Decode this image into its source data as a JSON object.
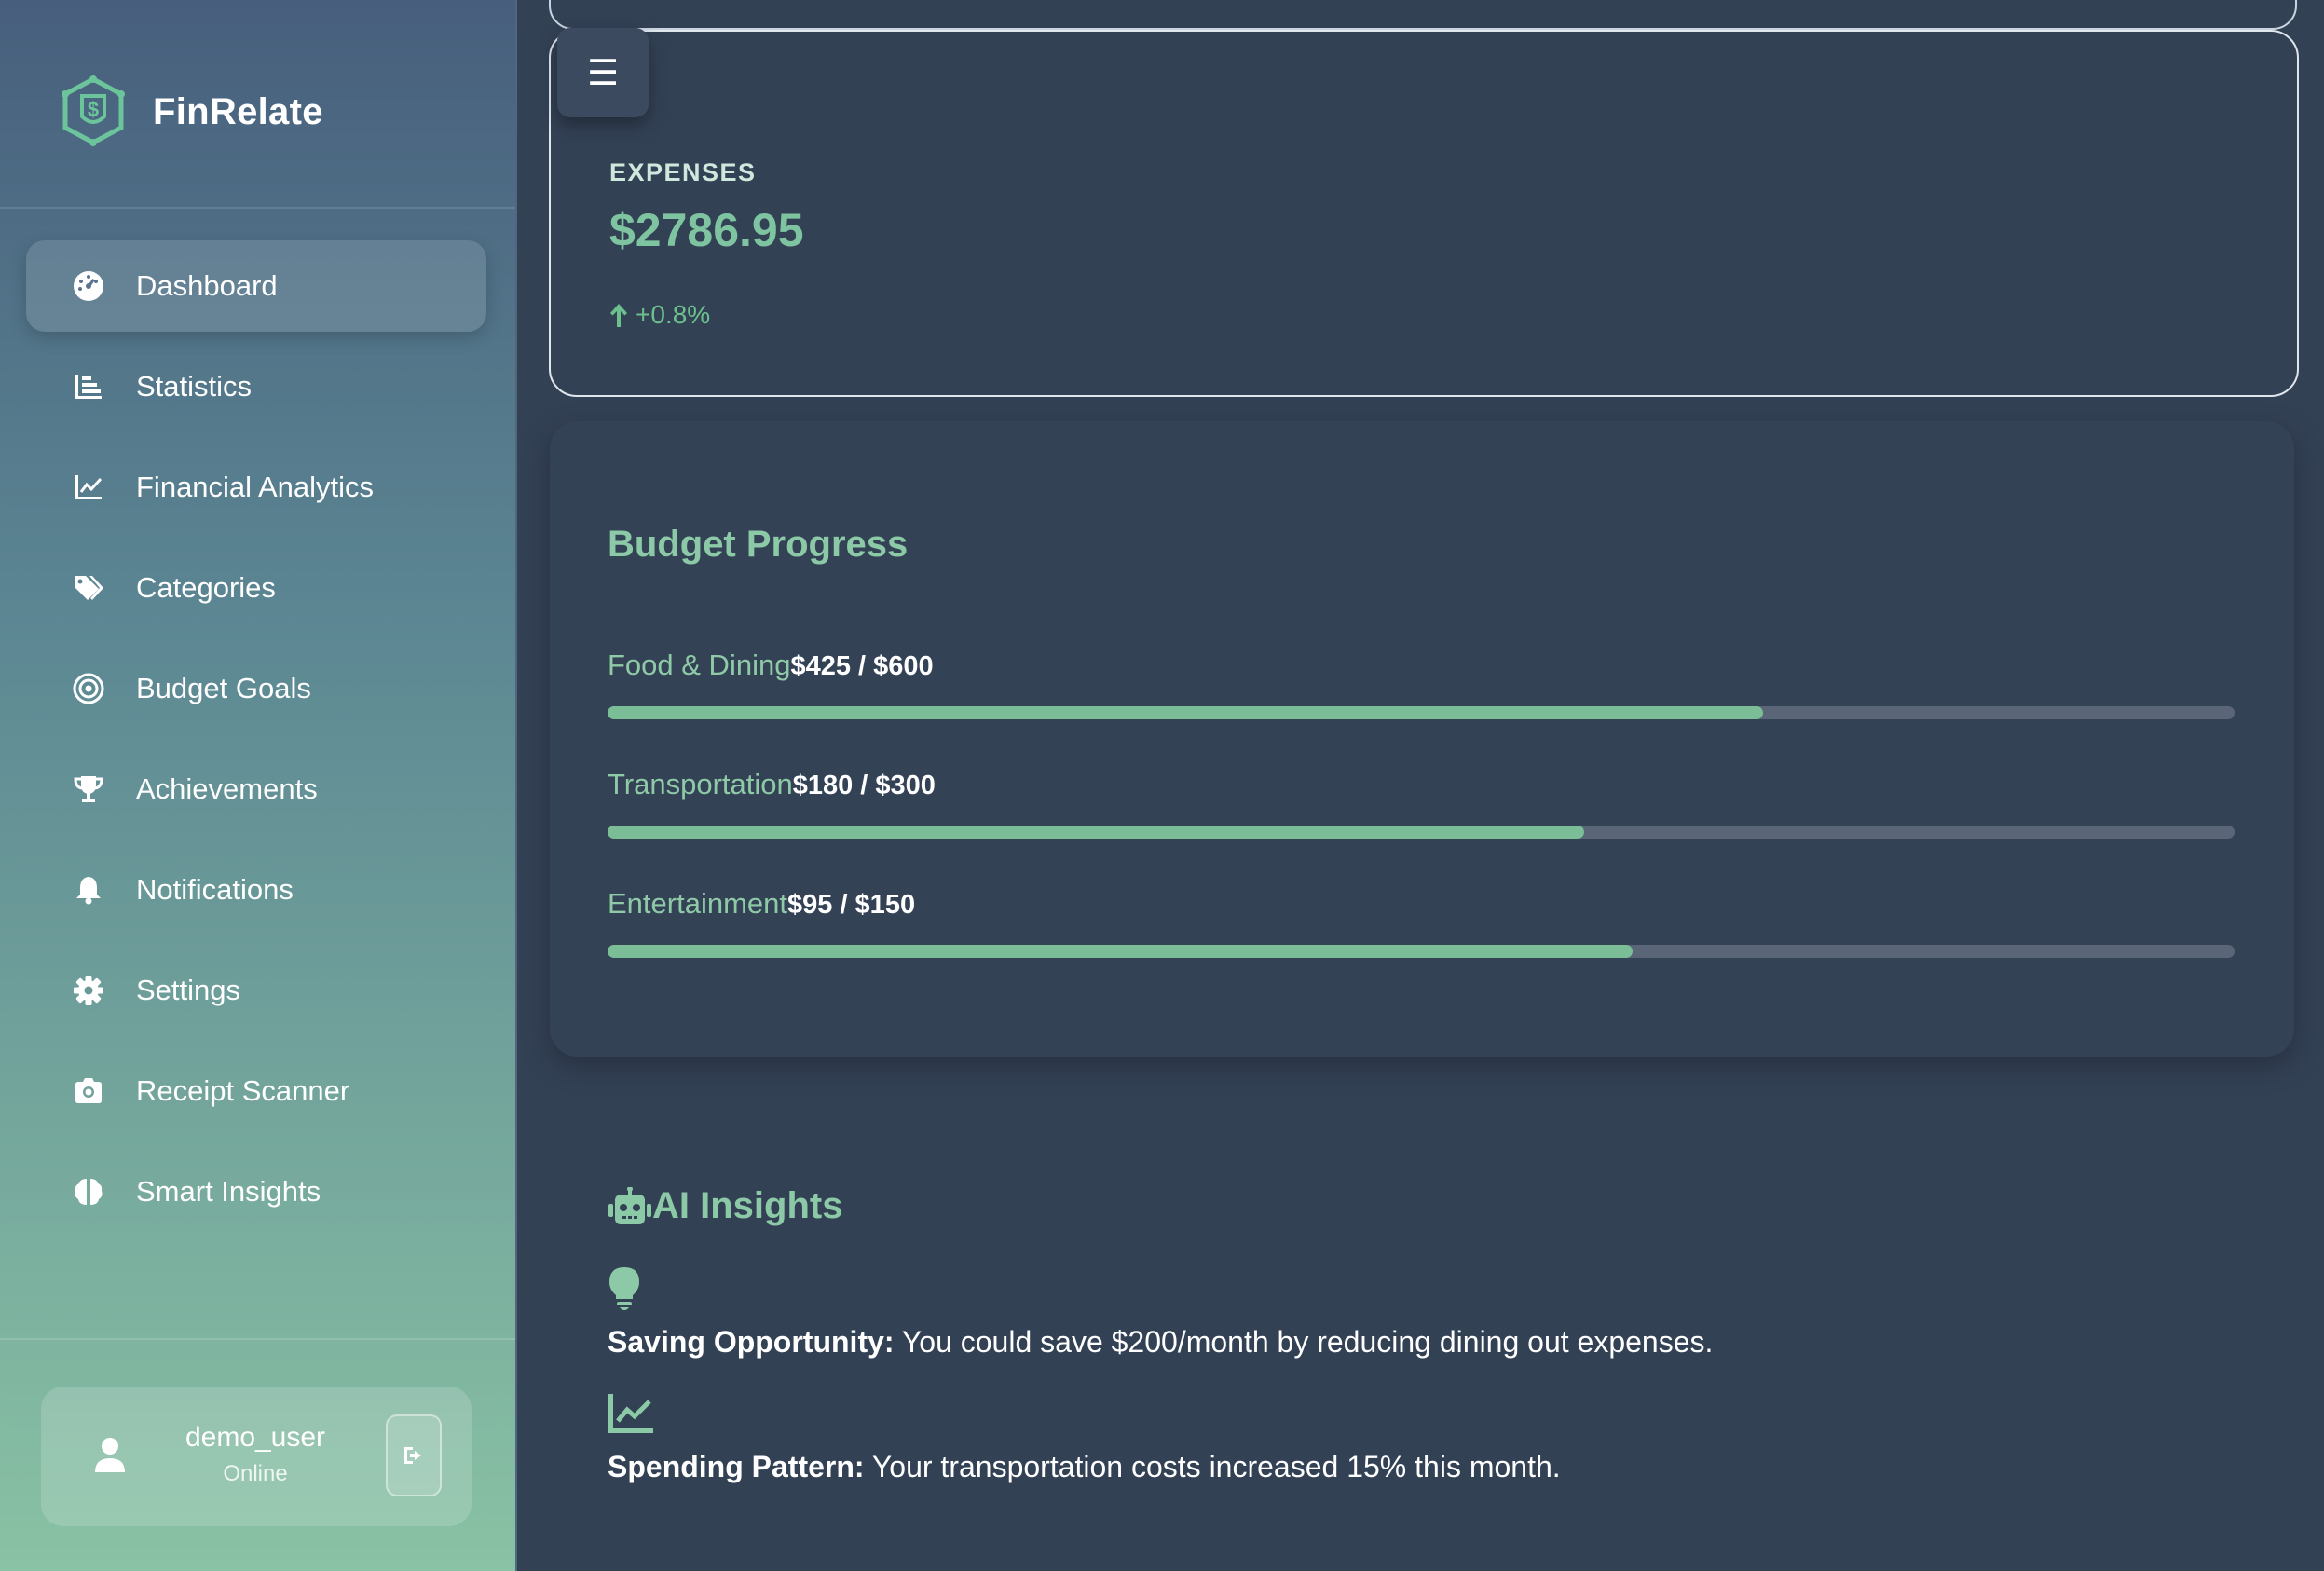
{
  "brand": {
    "name": "FinRelate"
  },
  "nav": [
    {
      "label": "Dashboard",
      "icon": "gauge-icon",
      "active": true
    },
    {
      "label": "Statistics",
      "icon": "bar-chart-icon",
      "active": false
    },
    {
      "label": "Financial Analytics",
      "icon": "line-chart-icon",
      "active": false
    },
    {
      "label": "Categories",
      "icon": "tags-icon",
      "active": false
    },
    {
      "label": "Budget Goals",
      "icon": "target-icon",
      "active": false
    },
    {
      "label": "Achievements",
      "icon": "trophy-icon",
      "active": false
    },
    {
      "label": "Notifications",
      "icon": "bell-icon",
      "active": false
    },
    {
      "label": "Settings",
      "icon": "gear-icon",
      "active": false
    },
    {
      "label": "Receipt Scanner",
      "icon": "camera-icon",
      "active": false
    },
    {
      "label": "Smart Insights",
      "icon": "brain-icon",
      "active": false
    }
  ],
  "user": {
    "name": "demo_user",
    "status": "Online"
  },
  "menu_button": {
    "glyph": "☰"
  },
  "expenses": {
    "label": "EXPENSES",
    "value": "$2786.95",
    "change": "+0.8%"
  },
  "budget": {
    "title": "Budget Progress",
    "items": [
      {
        "label": "Food & Dining",
        "amount": "$425 / $600",
        "progress": 0.71
      },
      {
        "label": "Transportation",
        "amount": "$180 / $300",
        "progress": 0.6
      },
      {
        "label": "Entertainment",
        "amount": "$95 / $150",
        "progress": 0.63
      }
    ]
  },
  "ai": {
    "title": "AI Insights",
    "insights": [
      {
        "icon": "lightbulb-icon",
        "title": "Saving Opportunity:",
        "text": " You could save $200/month by reducing dining out expenses."
      },
      {
        "icon": "line-chart-icon",
        "title": "Spending Pattern:",
        "text": " Your transportation costs increased 15% this month."
      }
    ]
  },
  "colors": {
    "accent": "#7bbd96",
    "background": "#334155",
    "track": "#5a6677"
  }
}
